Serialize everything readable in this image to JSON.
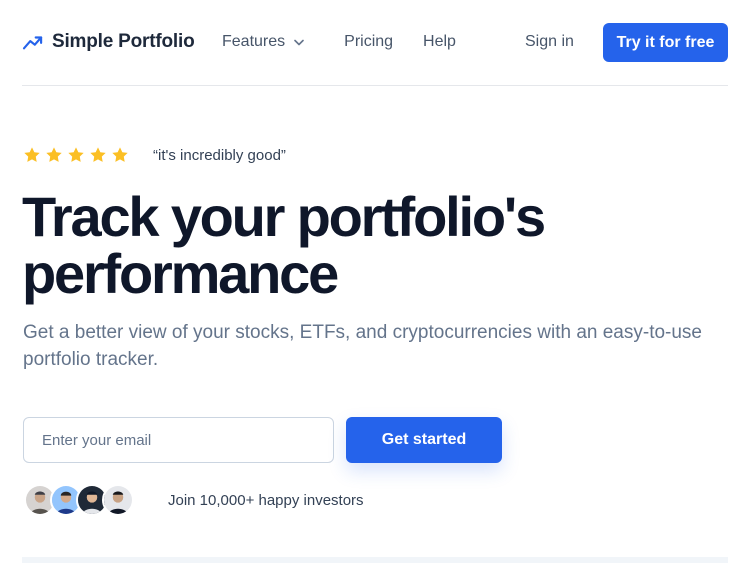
{
  "brand": {
    "name": "Simple Portfolio",
    "icon": "trending-up-icon",
    "accent": "#2563eb"
  },
  "nav": {
    "features": "Features",
    "pricing": "Pricing",
    "help": "Help",
    "sign_in": "Sign in",
    "cta": "Try it for free"
  },
  "hero": {
    "rating_stars": 5,
    "quote": "“it's incredibly good”",
    "headline_line1": "Track your portfolio's",
    "headline_line2": "performance",
    "subtext": "Get a better view of your stocks, ETFs, and cryptocurrencies with an easy-to-use portfolio tracker.",
    "email_placeholder": "Enter your email",
    "email_value": "",
    "cta": "Get started",
    "social_proof": "Join 10,000+ happy investors"
  },
  "colors": {
    "star": "#fbbf24",
    "heading": "#0f172a",
    "muted": "#64748b"
  }
}
